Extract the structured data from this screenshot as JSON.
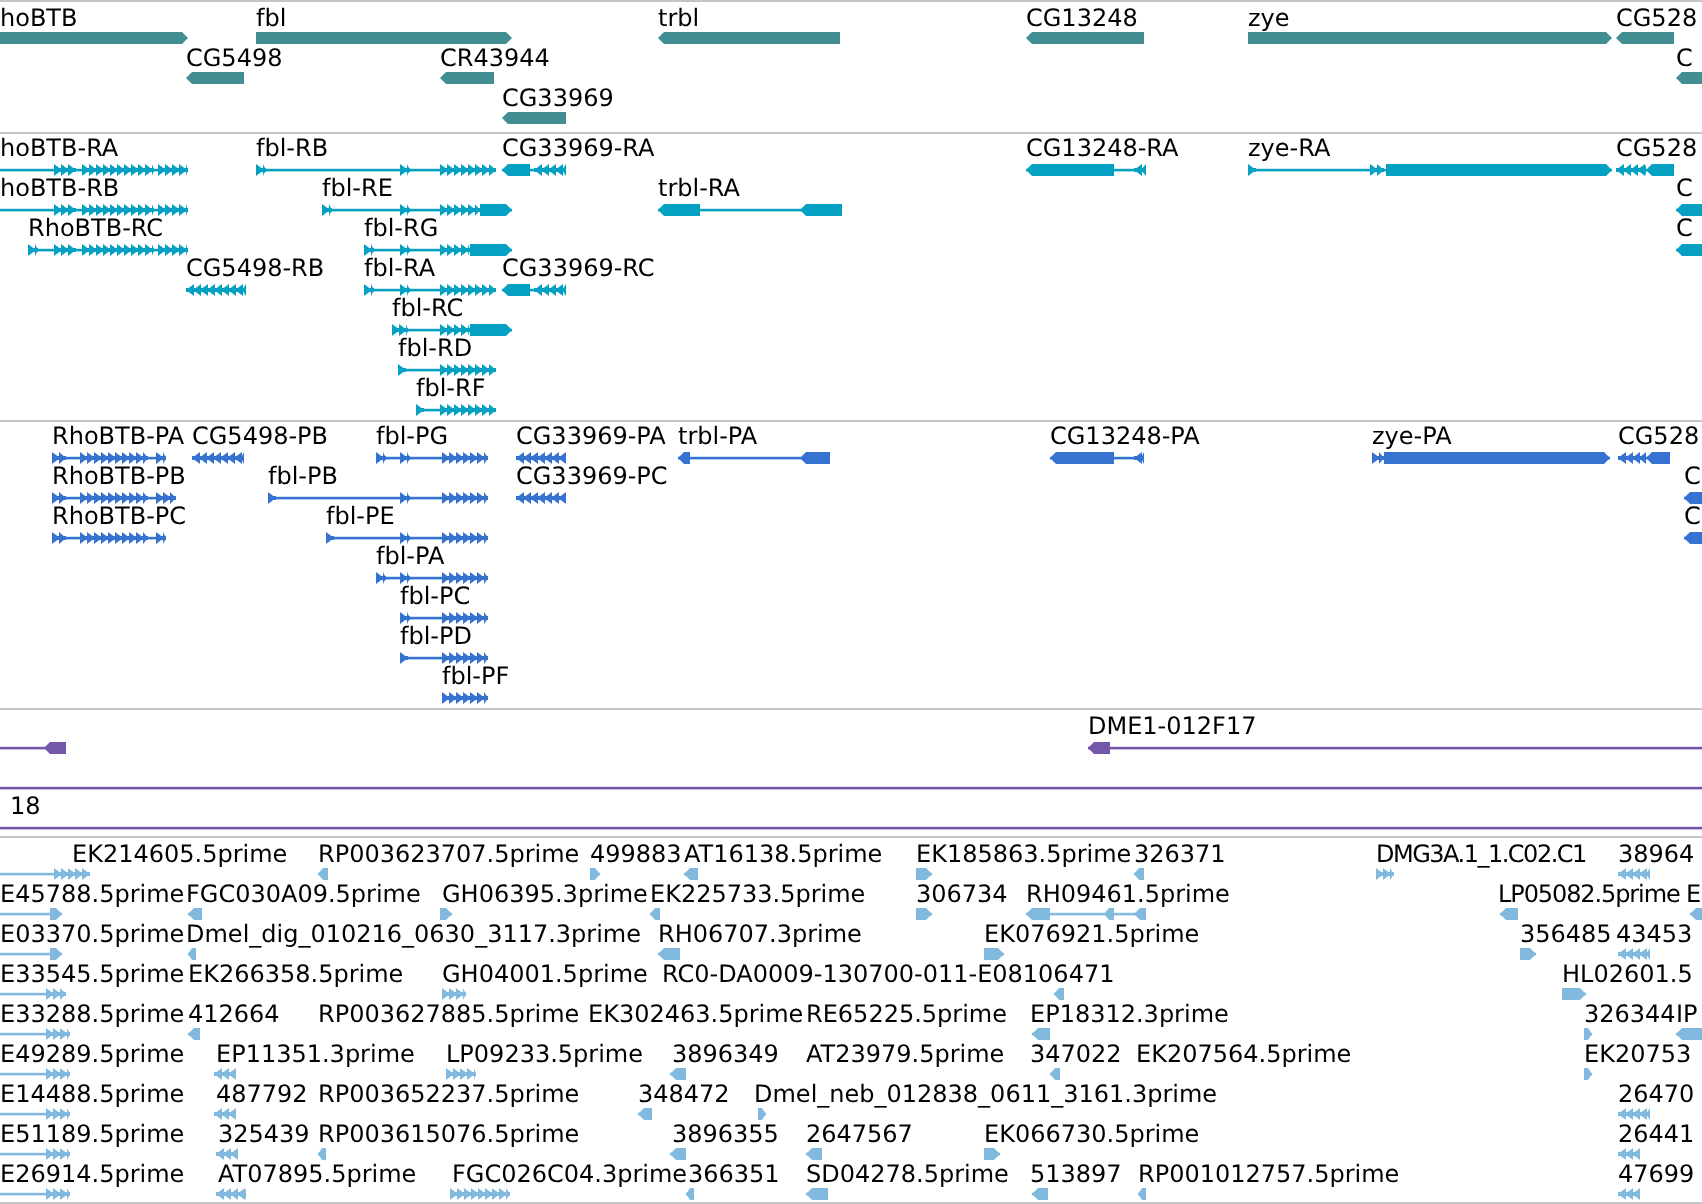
{
  "tracks": [
    {
      "kind": "gene",
      "features": [
        {
          "label": "hoBTB",
          "reverse": false
        },
        {
          "label": "fbl",
          "reverse": false
        },
        {
          "label": "trbl",
          "reverse": true
        },
        {
          "label": "CG13248",
          "reverse": true
        },
        {
          "label": "zye",
          "reverse": false
        },
        {
          "label": "CG528",
          "reverse": true
        },
        {
          "label": "CG5498",
          "reverse": true
        },
        {
          "label": "CR43944",
          "reverse": true
        },
        {
          "label": "C",
          "reverse": true
        },
        {
          "label": "CG33969",
          "reverse": true
        }
      ]
    },
    {
      "kind": "transcript",
      "features": [
        {
          "label": "hoBTB-RA",
          "reverse": false
        },
        {
          "label": "fbl-RB",
          "reverse": false
        },
        {
          "label": "CG33969-RA",
          "reverse": true
        },
        {
          "label": "CG13248-RA",
          "reverse": true
        },
        {
          "label": "zye-RA",
          "reverse": false
        },
        {
          "label": "CG528",
          "reverse": true
        },
        {
          "label": "hoBTB-RB",
          "reverse": false
        },
        {
          "label": "fbl-RE",
          "reverse": false
        },
        {
          "label": "trbl-RA",
          "reverse": true
        },
        {
          "label": "C",
          "reverse": true
        },
        {
          "label": "RhoBTB-RC",
          "reverse": false
        },
        {
          "label": "fbl-RG",
          "reverse": false
        },
        {
          "label": "C",
          "reverse": true
        },
        {
          "label": "CG5498-RB",
          "reverse": true
        },
        {
          "label": "fbl-RA",
          "reverse": false
        },
        {
          "label": "CG33969-RC",
          "reverse": true
        },
        {
          "label": "fbl-RC",
          "reverse": false
        },
        {
          "label": "fbl-RD",
          "reverse": false
        },
        {
          "label": "fbl-RF",
          "reverse": false
        }
      ]
    },
    {
      "kind": "protein",
      "features": [
        {
          "label": "RhoBTB-PA",
          "reverse": false
        },
        {
          "label": "CG5498-PB",
          "reverse": true
        },
        {
          "label": "fbl-PG",
          "reverse": false
        },
        {
          "label": "CG33969-PA",
          "reverse": true
        },
        {
          "label": "trbl-PA",
          "reverse": true
        },
        {
          "label": "CG13248-PA",
          "reverse": true
        },
        {
          "label": "zye-PA",
          "reverse": false
        },
        {
          "label": "CG528",
          "reverse": true
        },
        {
          "label": "RhoBTB-PB",
          "reverse": false
        },
        {
          "label": "fbl-PB",
          "reverse": false
        },
        {
          "label": "CG33969-PC",
          "reverse": true
        },
        {
          "label": "C",
          "reverse": true
        },
        {
          "label": "RhoBTB-PC",
          "reverse": false
        },
        {
          "label": "fbl-PE",
          "reverse": false
        },
        {
          "label": "C",
          "reverse": true
        },
        {
          "label": "fbl-PA",
          "reverse": false
        },
        {
          "label": "fbl-PC",
          "reverse": false
        },
        {
          "label": "fbl-PD",
          "reverse": false
        },
        {
          "label": "fbl-PF",
          "reverse": false
        }
      ]
    },
    {
      "kind": "clone",
      "features": [
        {
          "kind": "arrow",
          "reverse": true
        },
        {
          "label": "DME1-012F17",
          "kind": "arrow",
          "reverse": true
        },
        {
          "kind": "plain"
        },
        {
          "label": "18",
          "kind": "plain"
        }
      ]
    },
    {
      "kind": "est",
      "features": [
        {
          "label": "EK214605.5prime",
          "reverse": false
        },
        {
          "label": "RP003623707.5prime",
          "reverse": true
        },
        {
          "label": "499883",
          "reverse": false
        },
        {
          "label": "AT16138.5prime",
          "reverse": true
        },
        {
          "label": "EK185863.5prime",
          "reverse": false
        },
        {
          "label": "326371",
          "reverse": true
        },
        {
          "label": "DMG3A.1_1.C02.C1",
          "reverse": false
        },
        {
          "label": "38964",
          "reverse": true
        },
        {
          "label": "E45788.5prime",
          "reverse": false
        },
        {
          "label": "FGC030A09.5prime",
          "reverse": true
        },
        {
          "label": "GH06395.3prime",
          "reverse": false
        },
        {
          "label": "EK225733.5prime",
          "reverse": true
        },
        {
          "label": "306734",
          "reverse": false
        },
        {
          "label": "RH09461.5prime",
          "reverse": true
        },
        {
          "label": "LP05082.5prime",
          "reverse": true
        },
        {
          "label": "E",
          "reverse": true
        },
        {
          "label": "E03370.5prime",
          "reverse": false
        },
        {
          "label": "Dmel_dig_010216_0630_3117.3prime",
          "reverse": true
        },
        {
          "label": "RH06707.3prime",
          "reverse": true
        },
        {
          "label": "EK076921.5prime",
          "reverse": false
        },
        {
          "label": "356485",
          "reverse": false
        },
        {
          "label": "43453",
          "reverse": true
        },
        {
          "label": "E33545.5prime",
          "reverse": false
        },
        {
          "label": "EK266358.5prime"
        },
        {
          "label": "GH04001.5prime",
          "reverse": false
        },
        {
          "label": "RC0-DA0009-130700-011-E08106471",
          "reverse": true
        },
        {
          "label": "HL02601.5",
          "reverse": false
        },
        {
          "label": "E33288.5prime",
          "reverse": false
        },
        {
          "label": "412664",
          "reverse": true
        },
        {
          "label": "RP003627885.5prime"
        },
        {
          "label": "EK302463.5prime"
        },
        {
          "label": "RE65225.5prime"
        },
        {
          "label": "EP18312.3prime",
          "reverse": true
        },
        {
          "label": "326344",
          "reverse": false
        },
        {
          "label": "IP",
          "reverse": true
        },
        {
          "label": "E49289.5prime",
          "reverse": false
        },
        {
          "label": "EP11351.3prime",
          "reverse": true
        },
        {
          "label": "LP09233.5prime",
          "reverse": false
        },
        {
          "label": "3896349",
          "reverse": true
        },
        {
          "label": "AT23979.5prime"
        },
        {
          "label": "347022",
          "reverse": true
        },
        {
          "label": "EK207564.5prime"
        },
        {
          "label": "EK20753",
          "reverse": false
        },
        {
          "label": "E14488.5prime",
          "reverse": false
        },
        {
          "label": "487792",
          "reverse": true
        },
        {
          "label": "RP003652237.5prime"
        },
        {
          "label": "348472",
          "reverse": true
        },
        {
          "label": "Dmel_neb_012838_0611_3161.3prime",
          "reverse": false
        },
        {
          "label": "26470",
          "reverse": true
        },
        {
          "label": "E51189.5prime",
          "reverse": false
        },
        {
          "label": "325439",
          "reverse": true
        },
        {
          "label": "RP003615076.5prime",
          "reverse": true
        },
        {
          "label": "3896355",
          "reverse": true
        },
        {
          "label": "2647567",
          "reverse": true
        },
        {
          "label": "EK066730.5prime",
          "reverse": false
        },
        {
          "label": "26441",
          "reverse": true
        },
        {
          "label": "E26914.5prime",
          "reverse": false
        },
        {
          "label": "AT07895.5prime",
          "reverse": true
        },
        {
          "label": "FGC026C04.3prime",
          "reverse": false
        },
        {
          "label": "366351",
          "reverse": true
        },
        {
          "label": "SD04278.5prime",
          "reverse": true
        },
        {
          "label": "513897",
          "reverse": true
        },
        {
          "label": "RP001012757.5prime",
          "reverse": true
        },
        {
          "label": "47699",
          "reverse": true
        }
      ]
    }
  ]
}
